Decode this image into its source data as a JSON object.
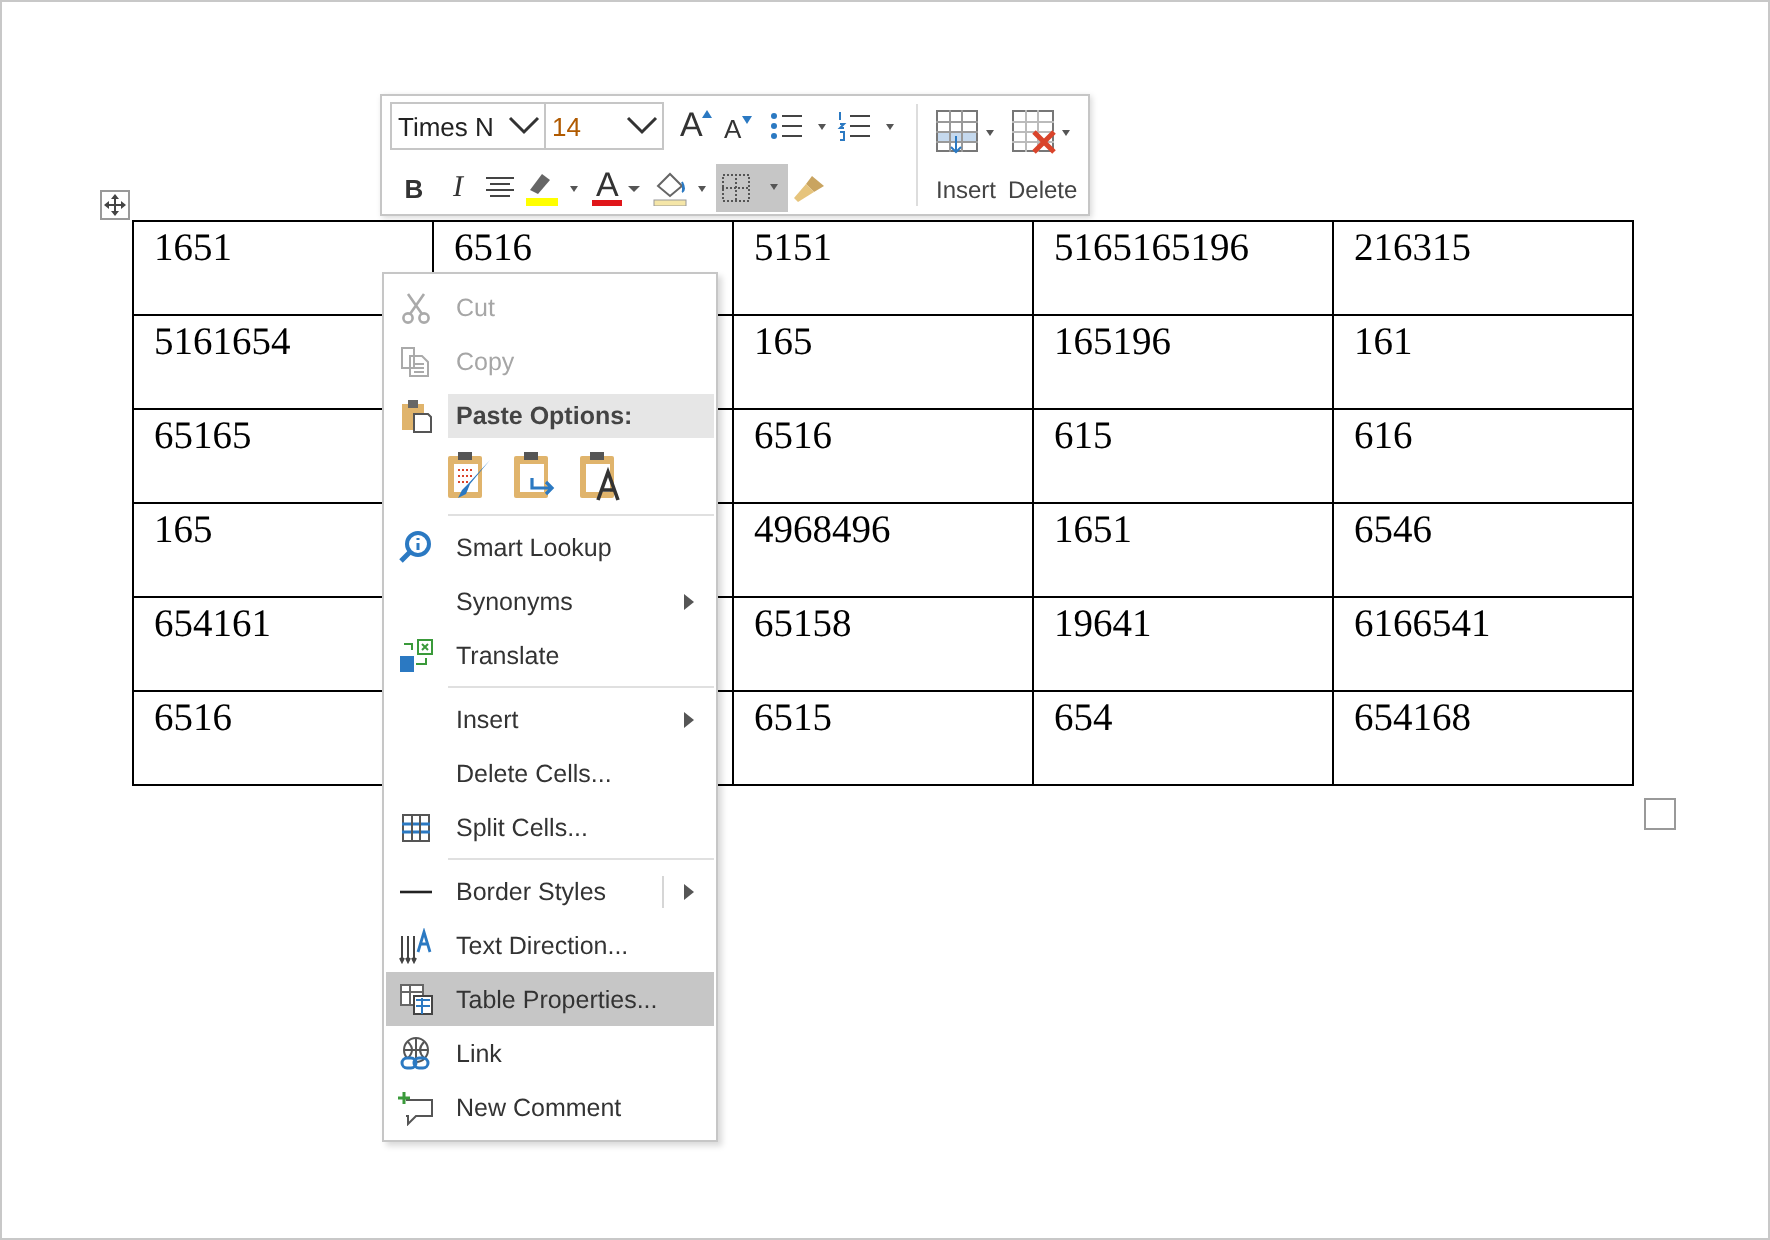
{
  "mini_toolbar": {
    "font": "Times N",
    "size": "14",
    "row1": [
      {
        "kind": "grow",
        "glyph": "A"
      },
      {
        "kind": "shrink",
        "glyph": "A"
      },
      {
        "kind": "bullets"
      },
      {
        "kind": "numbering"
      }
    ],
    "row2": [
      {
        "kind": "bold",
        "glyph": "B",
        "pressed": false
      },
      {
        "kind": "italic",
        "glyph": "I",
        "pressed": false
      },
      {
        "kind": "align",
        "pressed": false
      },
      {
        "kind": "highlight",
        "pressed": false
      },
      {
        "kind": "font_color",
        "glyph": "A",
        "pressed": false
      },
      {
        "kind": "shading",
        "pressed": false
      },
      {
        "kind": "borders",
        "pressed": true
      },
      {
        "kind": "painter",
        "pressed": false
      }
    ],
    "insert_label": "Insert",
    "delete_label": "Delete"
  },
  "table": {
    "rows": [
      [
        "1651",
        "6516",
        "5151",
        "5165165196",
        "216315"
      ],
      [
        "5161654",
        null,
        "165",
        "165196",
        "161"
      ],
      [
        "65165",
        null,
        "6516",
        "615",
        "616"
      ],
      [
        "165",
        null,
        "4968496",
        "1651",
        "6546"
      ],
      [
        "654161",
        null,
        "65158",
        "19641",
        "6166541"
      ],
      [
        "6516",
        null,
        "6515",
        "654",
        "654168"
      ]
    ]
  },
  "context_menu": {
    "items": [
      {
        "kind": "item",
        "label": "Cut",
        "disabled": true,
        "selected": false,
        "submenu": false,
        "submenu_split": false
      },
      {
        "kind": "item",
        "label": "Copy",
        "disabled": true,
        "selected": false,
        "submenu": false,
        "submenu_split": false
      },
      {
        "kind": "header",
        "label": "Paste Options:"
      },
      {
        "kind": "paste_icons"
      },
      {
        "kind": "separator"
      },
      {
        "kind": "item",
        "label": "Smart Lookup",
        "disabled": false,
        "selected": false,
        "submenu": false,
        "submenu_split": false
      },
      {
        "kind": "item",
        "label": "Synonyms",
        "disabled": false,
        "selected": false,
        "submenu": true,
        "submenu_split": false
      },
      {
        "kind": "item",
        "label": "Translate",
        "disabled": false,
        "selected": false,
        "submenu": false,
        "submenu_split": false
      },
      {
        "kind": "separator"
      },
      {
        "kind": "item",
        "label": "Insert",
        "disabled": false,
        "selected": false,
        "submenu": true,
        "submenu_split": false
      },
      {
        "kind": "item",
        "label": "Delete Cells...",
        "disabled": false,
        "selected": false,
        "submenu": false,
        "submenu_split": false
      },
      {
        "kind": "item",
        "label": "Split Cells...",
        "disabled": false,
        "selected": false,
        "submenu": false,
        "submenu_split": false
      },
      {
        "kind": "separator"
      },
      {
        "kind": "item",
        "label": "Border Styles",
        "disabled": false,
        "selected": false,
        "submenu": true,
        "submenu_split": true
      },
      {
        "kind": "item",
        "label": "Text Direction...",
        "disabled": false,
        "selected": false,
        "submenu": false,
        "submenu_split": false
      },
      {
        "kind": "item",
        "label": "Table Properties...",
        "disabled": false,
        "selected": true,
        "submenu": false,
        "submenu_split": false
      },
      {
        "kind": "item",
        "label": "Link",
        "disabled": false,
        "selected": false,
        "submenu": false,
        "submenu_split": false
      },
      {
        "kind": "item",
        "label": "New Comment",
        "disabled": false,
        "selected": false,
        "submenu": false,
        "submenu_split": false
      }
    ]
  }
}
